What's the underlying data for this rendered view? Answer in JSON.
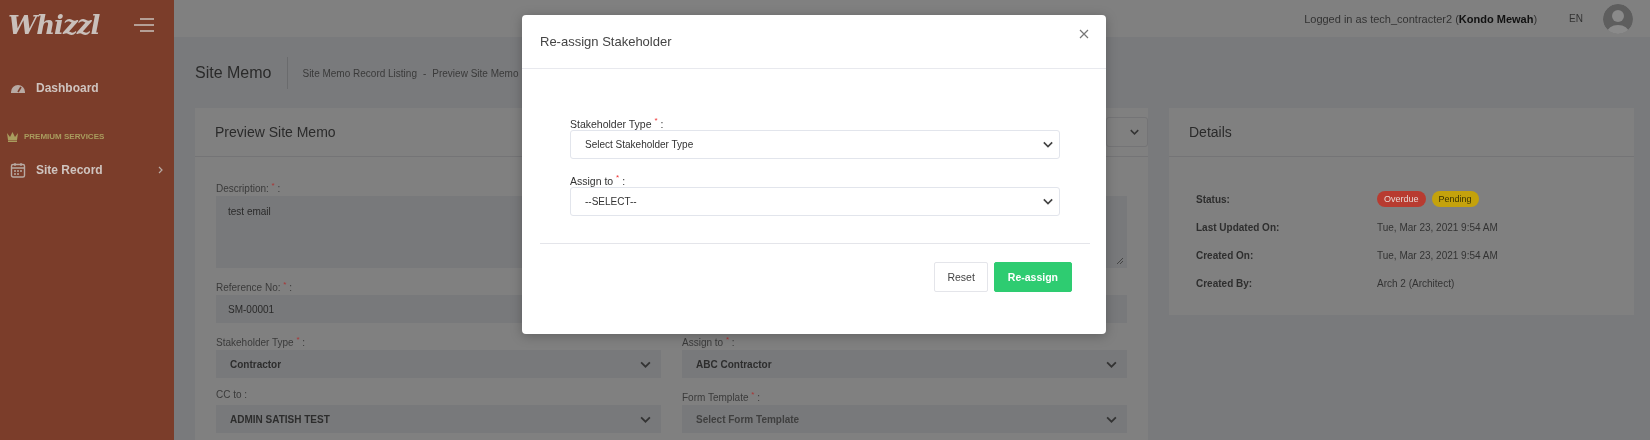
{
  "sidebar": {
    "logo": "Whizzl",
    "items": [
      {
        "kind": "link",
        "label": "Dashboard"
      },
      {
        "kind": "heading",
        "label": "PREMIUM SERVICES"
      },
      {
        "kind": "submenu",
        "label": "Site Record"
      }
    ]
  },
  "header": {
    "user": "Logged in as tech_contracter2 (**Kondo Mewah**)",
    "language": "EN"
  },
  "page": {
    "title": "Site Memo",
    "breadcrumb": [
      "Site Memo Record Listing",
      "Preview Site Memo"
    ],
    "breadcrumb_separator": "-"
  },
  "form_card": {
    "title": "Preview Site Memo",
    "fields": [
      {
        "kind": "textarea",
        "label": "Description: $^{*}$ :",
        "value": "test email"
      },
      {
        "kind": "text",
        "label": "Reference No: $^{*}$ :",
        "value": "SM-00001"
      },
      {
        "kind": "select",
        "label": "Stakeholder Type $^{*}$ :",
        "value": "Contractor"
      },
      {
        "kind": "select",
        "label": "Assign to $^{*}$ :",
        "value": "ABC Contractor"
      },
      {
        "kind": "select",
        "label": "CC to :",
        "value": "ADMIN SATISH TEST"
      },
      {
        "kind": "select",
        "label": "Form Template $^{*}$ :",
        "placeholder": "Select Form Template"
      }
    ]
  },
  "details_card": {
    "title": "Details",
    "rows": [
      {
        "kind": "badges",
        "label": "Status:",
        "badges": [
          {
            "text": "Overdue",
            "color": "#b83b30"
          },
          {
            "text": "Pending",
            "color": "#c4a20c"
          }
        ]
      },
      {
        "kind": "text",
        "label": "Last Updated On:",
        "value": "Tue, Mar 23, 2021 9:54 AM"
      },
      {
        "kind": "text",
        "label": "Created On:",
        "value": "Tue, Mar 23, 2021 9:54 AM"
      },
      {
        "kind": "text",
        "label": "Created By:",
        "value": "Arch 2 (Architect)"
      }
    ]
  },
  "modal": {
    "title": "Re-assign Stakeholder",
    "fields": [
      {
        "label": "Stakeholder Type $^{*}$ :",
        "placeholder": "Select Stakeholder Type"
      },
      {
        "label": "Assign to $^{*}$ :",
        "placeholder": "--SELECT--"
      }
    ],
    "buttons": [
      {
        "kind": "secondary",
        "label": "Reset"
      },
      {
        "kind": "primary",
        "label": "Re-assign"
      }
    ]
  }
}
